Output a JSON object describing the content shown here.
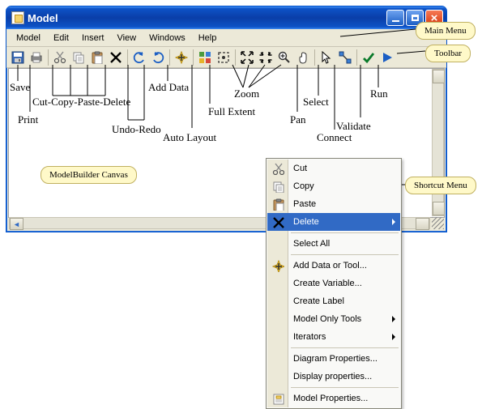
{
  "window": {
    "title": "Model"
  },
  "menubar": {
    "items": [
      "Model",
      "Edit",
      "Insert",
      "View",
      "Windows",
      "Help"
    ]
  },
  "toolbar": {
    "buttons": [
      {
        "name": "save-icon"
      },
      {
        "name": "print-icon"
      },
      {
        "sep": true
      },
      {
        "name": "cut-icon"
      },
      {
        "name": "copy-icon"
      },
      {
        "name": "paste-icon"
      },
      {
        "name": "delete-icon"
      },
      {
        "sep": true
      },
      {
        "name": "undo-icon"
      },
      {
        "name": "redo-icon"
      },
      {
        "sep": true
      },
      {
        "name": "add-data-icon"
      },
      {
        "sep": true
      },
      {
        "name": "auto-layout-icon"
      },
      {
        "name": "full-extent-icon"
      },
      {
        "sep": true
      },
      {
        "name": "zoom-in-fixed-icon"
      },
      {
        "name": "zoom-out-fixed-icon"
      },
      {
        "name": "zoom-in-icon"
      },
      {
        "name": "pan-icon"
      },
      {
        "sep": true
      },
      {
        "name": "select-icon"
      },
      {
        "name": "connect-icon"
      },
      {
        "sep": true
      },
      {
        "name": "validate-icon"
      },
      {
        "name": "run-icon"
      }
    ]
  },
  "annotations": {
    "main_menu": "Main Menu",
    "toolbar": "Toolbar",
    "canvas_label": "ModelBuilder Canvas",
    "shortcut_menu": "Shortcut Menu",
    "save": "Save",
    "print": "Print",
    "ccpd": "Cut-Copy-Paste-Delete",
    "undoredo": "Undo-Redo",
    "adddata": "Add Data",
    "autolayout": "Auto Layout",
    "fullextent": "Full Extent",
    "zoom": "Zoom",
    "pan": "Pan",
    "select": "Select",
    "connect": "Connect",
    "validate": "Validate",
    "run": "Run"
  },
  "context_menu": {
    "items": [
      {
        "icon": "cut-icon",
        "label": "Cut"
      },
      {
        "icon": "copy-icon",
        "label": "Copy"
      },
      {
        "icon": "paste-icon",
        "label": "Paste"
      },
      {
        "icon": "delete-icon",
        "label": "Delete",
        "highlighted": true,
        "submenu": true
      },
      {
        "sep": true
      },
      {
        "label": "Select All"
      },
      {
        "sep": true
      },
      {
        "icon": "add-data-icon",
        "label": "Add Data or Tool..."
      },
      {
        "label": "Create Variable..."
      },
      {
        "label": "Create Label"
      },
      {
        "label": "Model Only Tools",
        "submenu": true
      },
      {
        "label": "Iterators",
        "submenu": true
      },
      {
        "sep": true
      },
      {
        "label": "Diagram Properties..."
      },
      {
        "label": "Display properties..."
      },
      {
        "sep": true
      },
      {
        "icon": "model-properties-icon",
        "label": "Model Properties..."
      }
    ]
  }
}
